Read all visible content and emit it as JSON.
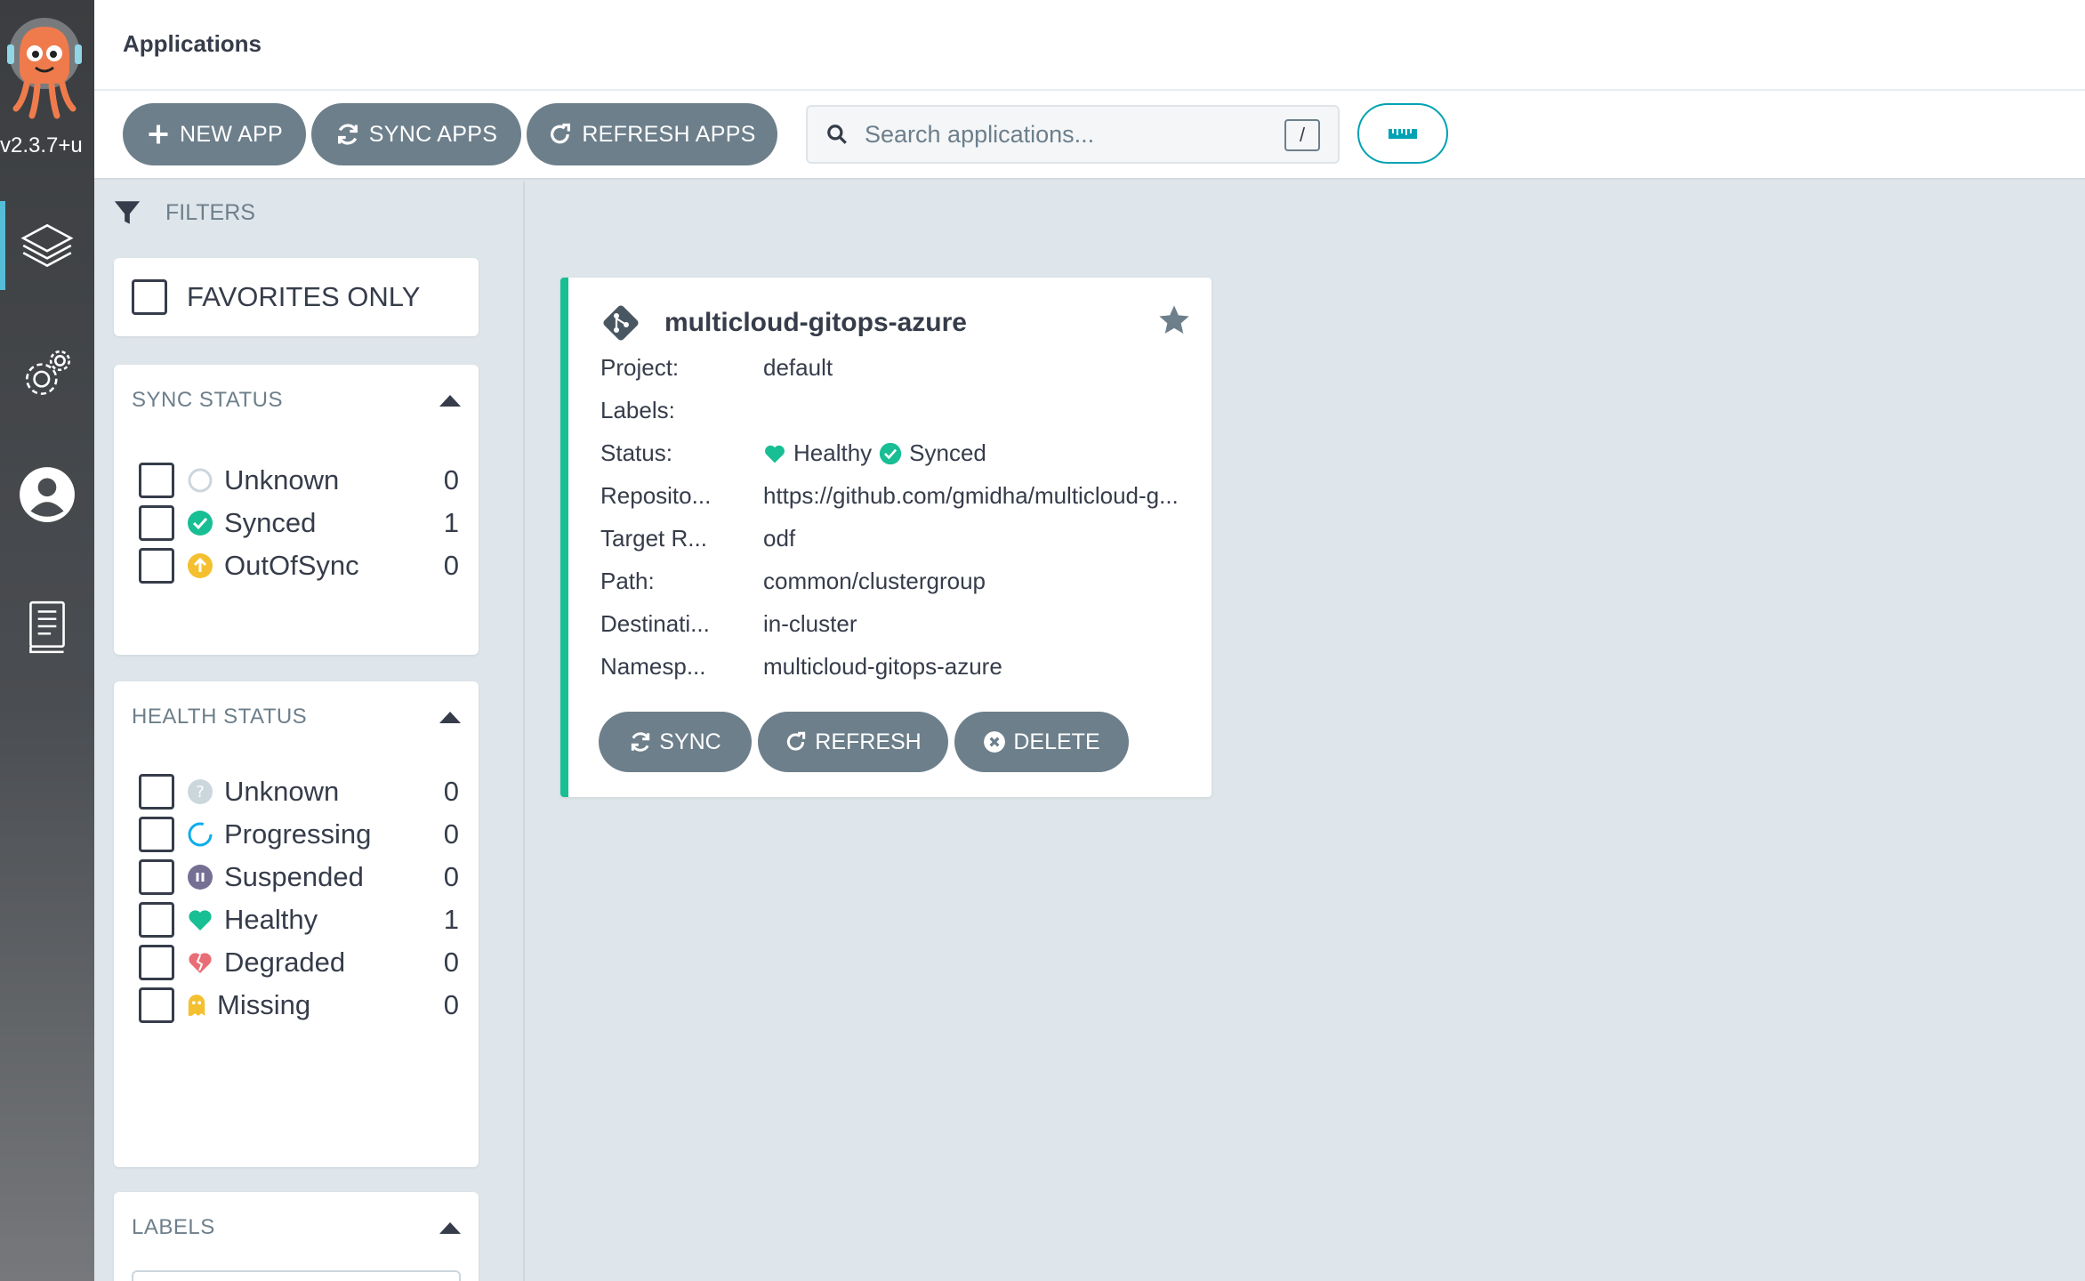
{
  "nav": {
    "version": "v2.3.7+u",
    "items": [
      {
        "name": "applications",
        "icon": "layers-icon"
      },
      {
        "name": "settings",
        "icon": "gears-icon"
      },
      {
        "name": "user-info",
        "icon": "user-icon"
      },
      {
        "name": "documentation",
        "icon": "book-icon"
      }
    ]
  },
  "header": {
    "title": "Applications"
  },
  "toolbar": {
    "new_app": "NEW APP",
    "sync_apps": "SYNC APPS",
    "refresh_apps": "REFRESH APPS",
    "search_placeholder": "Search applications...",
    "search_shortcut": "/"
  },
  "filters": {
    "title": "FILTERS",
    "favorites_only": "FAVORITES ONLY",
    "sync_status": {
      "title": "SYNC STATUS",
      "items": [
        {
          "label": "Unknown",
          "count": "0",
          "icon": "circle-outline-icon"
        },
        {
          "label": "Synced",
          "count": "1",
          "icon": "check-circle-icon"
        },
        {
          "label": "OutOfSync",
          "count": "0",
          "icon": "arrow-up-circle-icon"
        }
      ]
    },
    "health_status": {
      "title": "HEALTH STATUS",
      "items": [
        {
          "label": "Unknown",
          "count": "0",
          "icon": "question-circle-icon"
        },
        {
          "label": "Progressing",
          "count": "0",
          "icon": "spinner-icon"
        },
        {
          "label": "Suspended",
          "count": "0",
          "icon": "pause-circle-icon"
        },
        {
          "label": "Healthy",
          "count": "1",
          "icon": "heart-icon"
        },
        {
          "label": "Degraded",
          "count": "0",
          "icon": "broken-heart-icon"
        },
        {
          "label": "Missing",
          "count": "0",
          "icon": "ghost-icon"
        }
      ]
    },
    "labels": {
      "title": "LABELS"
    }
  },
  "app": {
    "name": "multicloud-gitops-azure",
    "fields": [
      {
        "key": "Project:",
        "value": "default"
      },
      {
        "key": "Labels:",
        "value": ""
      },
      {
        "key": "Status:",
        "health": "Healthy",
        "sync": "Synced"
      },
      {
        "key": "Reposito...",
        "value": "https://github.com/gmidha/multicloud-g..."
      },
      {
        "key": "Target R...",
        "value": "odf"
      },
      {
        "key": "Path:",
        "value": "common/clustergroup"
      },
      {
        "key": "Destinati...",
        "value": "in-cluster"
      },
      {
        "key": "Namesp...",
        "value": "multicloud-gitops-azure"
      }
    ],
    "actions": {
      "sync": "SYNC",
      "refresh": "REFRESH",
      "delete": "DELETE"
    }
  },
  "colors": {
    "accent": "#00a2b3",
    "healthy": "#18be94",
    "out_of_sync": "#f4c030",
    "degraded": "#e96d76",
    "suspended": "#766f94",
    "progressing": "#0dadea",
    "button": "#6d7f8b"
  }
}
